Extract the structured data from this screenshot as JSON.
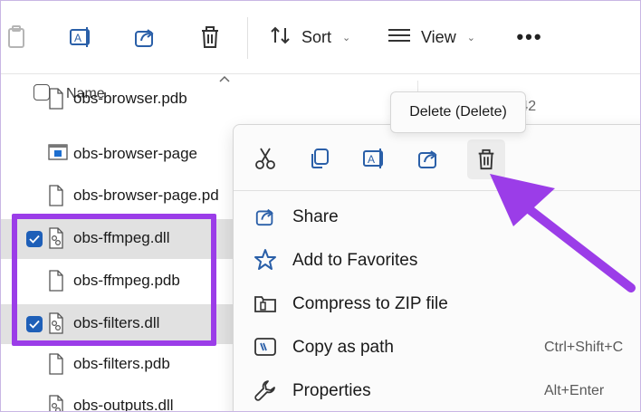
{
  "toolbar": {
    "sort_label": "Sort",
    "view_label": "View",
    "more_label": "•••"
  },
  "list": {
    "name_header": "Name",
    "date_header_fragment": "6.42",
    "rows": [
      {
        "name": "obs-browser.pdb",
        "selected": false,
        "type": "file"
      },
      {
        "name": "obs-browser-page",
        "selected": false,
        "type": "app"
      },
      {
        "name": "obs-browser-page.pd",
        "selected": false,
        "type": "file"
      },
      {
        "name": "obs-ffmpeg.dll",
        "selected": true,
        "type": "dll"
      },
      {
        "name": "obs-ffmpeg.pdb",
        "selected": false,
        "type": "file"
      },
      {
        "name": "obs-filters.dll",
        "selected": true,
        "type": "dll"
      },
      {
        "name": "obs-filters.pdb",
        "selected": false,
        "type": "file"
      },
      {
        "name": "obs-outputs.dll",
        "selected": false,
        "type": "dll"
      }
    ]
  },
  "context_menu": {
    "tooltip": "Delete (Delete)",
    "top_icons": [
      "cut-icon",
      "copy-icon",
      "rename-icon",
      "share-icon",
      "delete-icon"
    ],
    "items": [
      {
        "label": "Share",
        "shortcut": "",
        "icon": "share-icon"
      },
      {
        "label": "Add to Favorites",
        "shortcut": "",
        "icon": "star-icon"
      },
      {
        "label": "Compress to ZIP file",
        "shortcut": "",
        "icon": "zip-folder-icon"
      },
      {
        "label": "Copy as path",
        "shortcut": "Ctrl+Shift+C",
        "icon": "copy-path-icon"
      },
      {
        "label": "Properties",
        "shortcut": "Alt+Enter",
        "icon": "wrench-icon"
      }
    ]
  },
  "colors": {
    "accent": "#1e5fb8",
    "highlight": "#9b3de8",
    "selected_row": "#e1e1e1"
  }
}
